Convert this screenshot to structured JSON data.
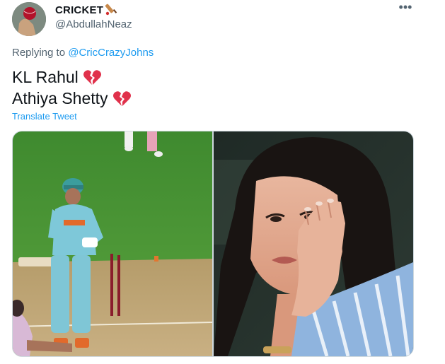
{
  "author": {
    "display_name": "CRICKET",
    "handle": "@AbdullahNeaz",
    "avatar_icon": "cricket-ball-avatar-icon",
    "name_emoji": "cricket-bat-icon"
  },
  "menu": {
    "more_label": "•••"
  },
  "reply": {
    "prefix": "Replying to",
    "mention": "@CricCrazyJohns"
  },
  "tweet": {
    "lines": [
      {
        "text": "KL Rahul",
        "emoji": "broken-heart-icon"
      },
      {
        "text": "Athiya Shetty",
        "emoji": "broken-heart-icon"
      }
    ],
    "translate_label": "Translate Tweet"
  },
  "media": {
    "photos": [
      {
        "name": "cricket-batsman-bowled-photo",
        "content": "batsman-with-broken-stumps"
      },
      {
        "name": "spectator-sad-reaction-photo",
        "content": "woman-resting-cheek-on-hand"
      }
    ]
  },
  "colors": {
    "link": "#1d9bf0",
    "secondary_text": "#536471",
    "primary_text": "#0f1419",
    "broken_heart": "#e0314b",
    "border": "#cfd9de"
  }
}
